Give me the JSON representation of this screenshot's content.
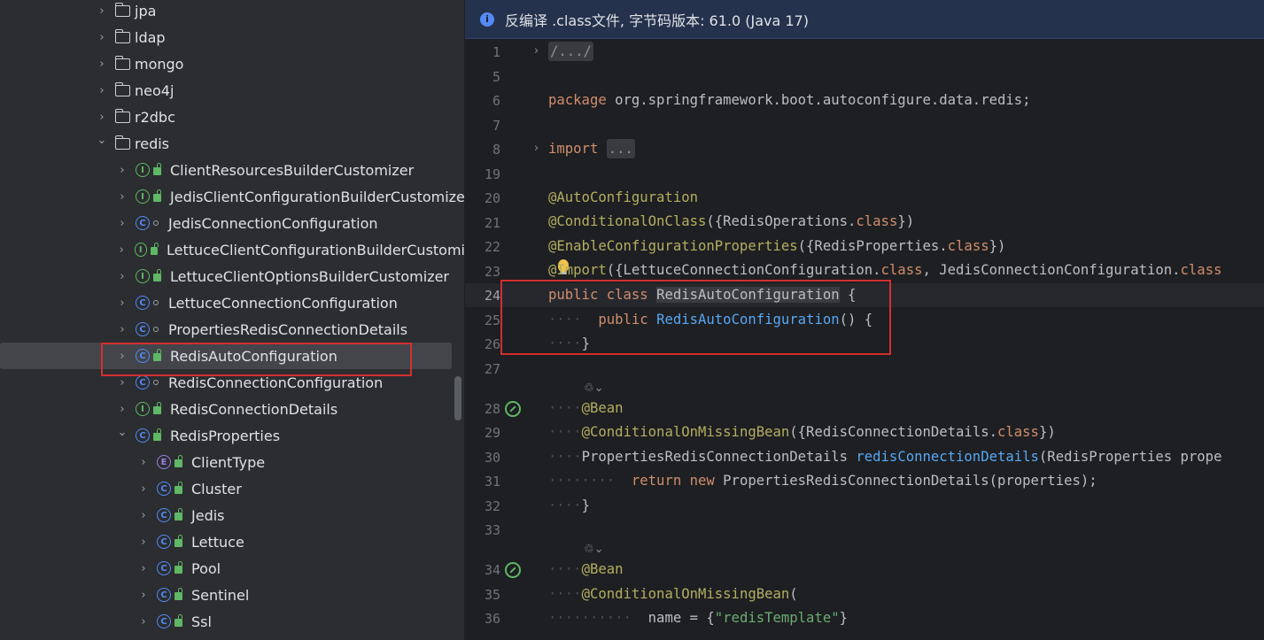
{
  "tree": {
    "rows": [
      {
        "label": "jpa",
        "kind": "folder",
        "chevron": ">"
      },
      {
        "label": "ldap",
        "kind": "folder",
        "chevron": ">"
      },
      {
        "label": "mongo",
        "kind": "folder",
        "chevron": ">"
      },
      {
        "label": "neo4j",
        "kind": "folder",
        "chevron": ">"
      },
      {
        "label": "r2dbc",
        "kind": "folder",
        "chevron": ">"
      },
      {
        "label": "redis",
        "kind": "folder",
        "chevron": "v"
      },
      {
        "label": "ClientResourcesBuilderCustomizer",
        "kind": "I",
        "chevron": ">"
      },
      {
        "label": "JedisClientConfigurationBuilderCustomize",
        "kind": "I",
        "chevron": ">"
      },
      {
        "label": "JedisConnectionConfiguration",
        "kind": "C",
        "chevron": ">",
        "pkg": true
      },
      {
        "label": "LettuceClientConfigurationBuilderCustomi",
        "kind": "I",
        "chevron": ">"
      },
      {
        "label": "LettuceClientOptionsBuilderCustomizer",
        "kind": "I",
        "chevron": ">"
      },
      {
        "label": "LettuceConnectionConfiguration",
        "kind": "C",
        "chevron": ">",
        "pkg": true
      },
      {
        "label": "PropertiesRedisConnectionDetails",
        "kind": "C",
        "chevron": ">",
        "pkg": true
      },
      {
        "label": "RedisAutoConfiguration",
        "kind": "C",
        "chevron": ">",
        "selected": true
      },
      {
        "label": "RedisConnectionConfiguration",
        "kind": "C",
        "chevron": ">",
        "pkg": true
      },
      {
        "label": "RedisConnectionDetails",
        "kind": "I",
        "chevron": ">"
      },
      {
        "label": "RedisProperties",
        "kind": "C",
        "chevron": "v"
      },
      {
        "label": "ClientType",
        "kind": "E",
        "chevron": ">"
      },
      {
        "label": "Cluster",
        "kind": "C",
        "chevron": ">"
      },
      {
        "label": "Jedis",
        "kind": "C",
        "chevron": ">"
      },
      {
        "label": "Lettuce",
        "kind": "C",
        "chevron": ">"
      },
      {
        "label": "Pool",
        "kind": "C",
        "chevron": ">"
      },
      {
        "label": "Sentinel",
        "kind": "C",
        "chevron": ">"
      },
      {
        "label": "Ssl",
        "kind": "C",
        "chevron": ">"
      }
    ]
  },
  "editor": {
    "banner": "反编译 .class文件, 字节码版本: 61.0 (Java 17)",
    "info_icon": "i",
    "hint_icon": "♲⌄",
    "line_numbers": [
      "1",
      "5",
      "6",
      "7",
      "8",
      "19",
      "20",
      "21",
      "22",
      "23",
      "24",
      "25",
      "26",
      "27",
      "28",
      "29",
      "30",
      "31",
      "32",
      "33",
      "34",
      "35",
      "36"
    ],
    "code": {
      "l1": "/.../",
      "l6_kw": "package",
      "l6_rest": " org.springframework.boot.autoconfigure.data.redis;",
      "l8_kw": "import",
      "l8_fold": "...",
      "l20": "@AutoConfiguration",
      "l21_ann": "@ConditionalOnClass",
      "l21_a": "({RedisOperations.",
      "l21_kw": "class",
      "l21_b": "})",
      "l22_ann": "@EnableConfigurationProperties",
      "l22_a": "({RedisProperties.",
      "l22_kw": "class",
      "l22_b": "})",
      "l23_ann": "@Import",
      "l23_a": "({LettuceConnectionConfiguration.",
      "l23_kw": "class",
      "l23_b": ", JedisConnectionConfiguration.",
      "l23_kw2": "class",
      "l24_kw": "public class",
      "l24_name": "RedisAutoConfiguration",
      "l24_b": " {",
      "l25_kw": "public",
      "l25_fn": "RedisAutoConfiguration",
      "l25_b": "() {",
      "l26": "}",
      "l28": "@Bean",
      "l29_ann": "@ConditionalOnMissingBean",
      "l29_a": "({RedisConnectionDetails.",
      "l29_kw": "class",
      "l29_b": "})",
      "l30_a": "PropertiesRedisConnectionDetails ",
      "l30_fn": "redisConnectionDetails",
      "l30_b": "(RedisProperties prope",
      "l31_kw": "return new",
      "l31_b": " PropertiesRedisConnectionDetails(properties);",
      "l32": "}",
      "l34": "@Bean",
      "l35_ann": "@ConditionalOnMissingBean",
      "l35_b": "(",
      "l36_a": "name = {",
      "l36_str": "\"redisTemplate\"",
      "l36_b": "}"
    }
  },
  "colors": {
    "highlight": "#d32f2f",
    "accent": "#548af7",
    "interface": "#5fb865"
  }
}
